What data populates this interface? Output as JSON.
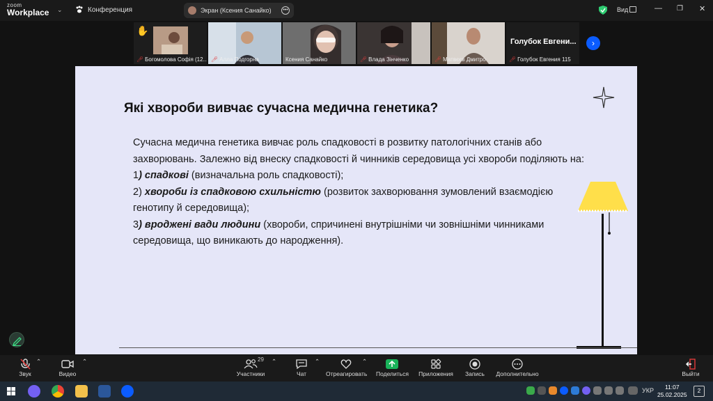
{
  "app": {
    "brand_small": "zoom",
    "brand_big": "Workplace",
    "meeting_label": "Конференция"
  },
  "screen_share": {
    "label": "Экран (Ксения Санайко)"
  },
  "view_label": "Вид",
  "participants": [
    {
      "name": "Богомолова Софія (12...",
      "muted": true,
      "hand_raised": true
    },
    {
      "name": "Алла Подгорна",
      "muted": true
    },
    {
      "name": "Ксения Санайко",
      "muted": false,
      "active": true
    },
    {
      "name": "Влада Зінченко",
      "muted": true
    },
    {
      "name": "Матвєєв Дмитро",
      "muted": true
    },
    {
      "name": "Голубок Евгения 115",
      "muted": true,
      "display_name": "Голубок Евгени..."
    }
  ],
  "slide": {
    "title": "Які хвороби вивчає сучасна медична генетика?",
    "intro": "Сучасна медична генетика вивчає роль спадковості в розвитку патологічних станів або захворювань. Залежно від внеску спадковості й чинників середовища усі хвороби поділяють на:",
    "item1_num": "1",
    "item1_bold": ") спадкові",
    "item1_rest": " (визначальна роль спадковості);",
    "item2_num": "2) ",
    "item2_bold": "хвороби із спадковою схильністю",
    "item2_rest": " (розвиток захворювання зумовлений взаємодією генотипу й середовища);",
    "item3_num": "3",
    "item3_bold": ") вроджені вади людини",
    "item3_rest": " (хвороби, спричинені внутрішніми чи зовнішніми чинниками середовища, що виникають до народження)."
  },
  "toolbar": {
    "audio": "Звук",
    "video": "Видео",
    "participants": "Участники",
    "participants_count": "29",
    "chat": "Чат",
    "react": "Отреагировать",
    "share": "Поделиться",
    "apps": "Приложения",
    "record": "Запись",
    "more": "Дополнительно",
    "leave": "Выйти"
  },
  "taskbar": {
    "lang": "УКР",
    "time": "11:07",
    "date": "25.02.2025",
    "notifications": "2"
  },
  "colors": {
    "accent_green": "#2ecc71",
    "share_green": "#19b35a",
    "mute_red": "#e23b3b",
    "slide_bg": "#e5e6f8"
  }
}
